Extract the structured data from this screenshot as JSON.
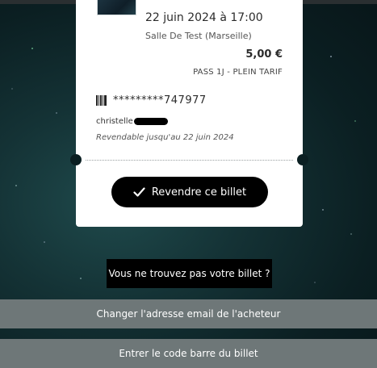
{
  "ticket": {
    "date_time": "22 juin 2024 à 17:00",
    "venue": "Salle De Test (Marseille)",
    "price": "5,00 €",
    "rate": "PASS 1J - PLEIN TARIF",
    "barcode_masked": "*********747977",
    "owner_name": "christelle",
    "resale_until": "Revendable jusqu'au 22 juin 2024"
  },
  "actions": {
    "resell_label": "Revendre ce billet",
    "not_found_label": "Vous ne trouvez pas votre billet ?",
    "change_email_label": "Changer l'adresse email de l'acheteur",
    "enter_barcode_label": "Entrer le code barre du billet"
  },
  "colors": {
    "background": "#143235",
    "button": "#000000",
    "footer_bar": "#6e7778"
  }
}
